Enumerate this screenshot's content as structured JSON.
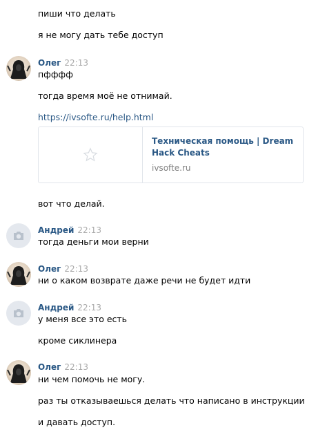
{
  "intro": {
    "lines": [
      "пиши что делать",
      "я не могу дать тебе доступ"
    ]
  },
  "group1": {
    "author": "Олег",
    "time": "22:13",
    "lines": [
      "пфффф",
      "тогда время моё не отнимай."
    ],
    "link": "https://ivsofte.ru/help.html",
    "card": {
      "title": "Техническая помощь | Dream Hack Cheats",
      "domain": "ivsofte.ru"
    },
    "after": "вот что делай."
  },
  "group2": {
    "author": "Андрей",
    "time": "22:13",
    "lines": [
      "тогда деньги мои верни"
    ]
  },
  "group3": {
    "author": "Олег",
    "time": "22:13",
    "lines": [
      "ни о каком возврате даже речи не будет идти"
    ]
  },
  "group4": {
    "author": "Андрей",
    "time": "22:13",
    "lines": [
      "у меня все это есть",
      "кроме сиклинера"
    ]
  },
  "group5": {
    "author": "Олег",
    "time": "22:13",
    "lines": [
      "ни чем помочь не могу.",
      "раз ты отказываешься делать что написано в инструкции",
      "и давать доступ."
    ]
  },
  "colors": {
    "author": "#2a5885",
    "time": "#aaaaaa",
    "link": "#2a5885",
    "card_border": "#e1e5eb"
  },
  "icons": {
    "oleg_avatar": "avatar-hooded-figure-icon",
    "andrey_avatar": "camera-icon",
    "card_thumb": "star-icon"
  }
}
